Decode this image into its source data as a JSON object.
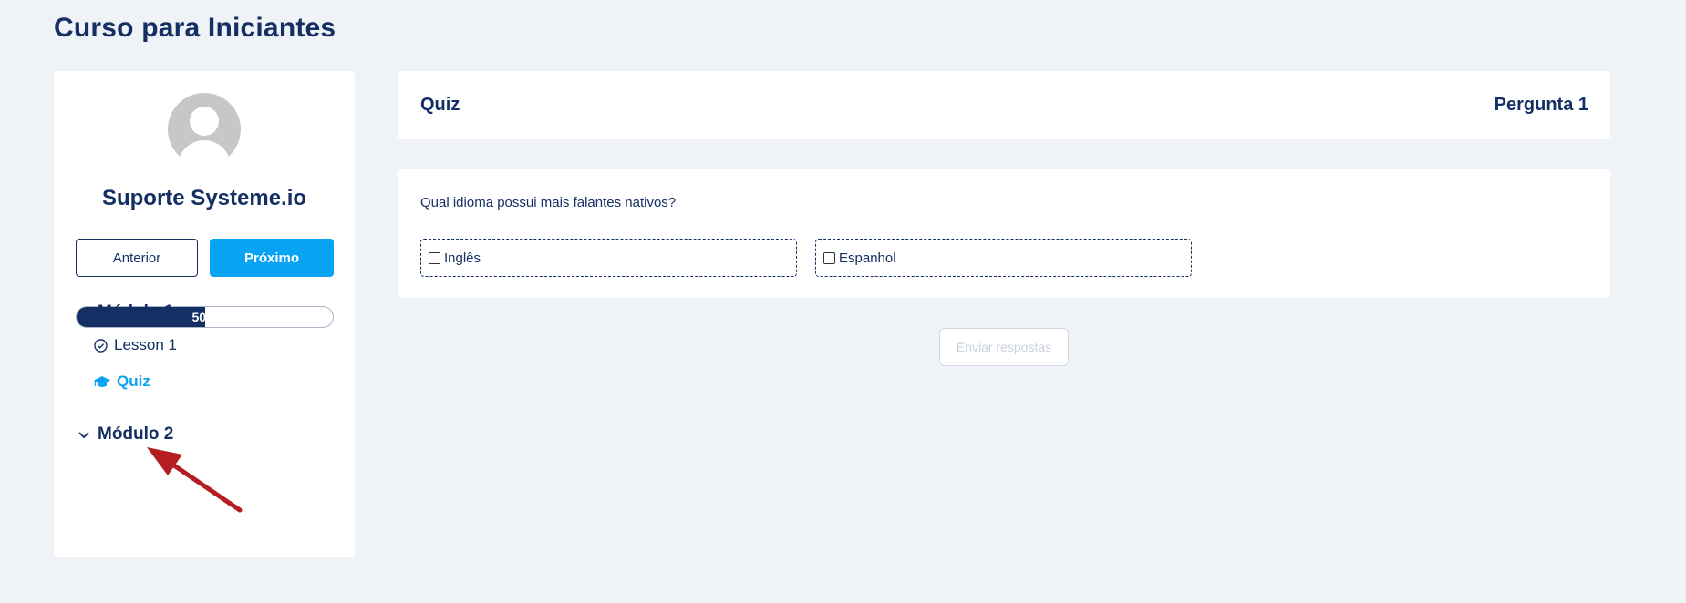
{
  "page": {
    "title": "Curso para Iniciantes"
  },
  "sidebar": {
    "user_name": "Suporte Systeme.io",
    "prev_label": "Anterior",
    "next_label": "Próximo",
    "progress_label": "50%",
    "progress_value": 0.5,
    "modules": [
      {
        "label": "Módulo 1",
        "expanded": true,
        "lessons": [
          {
            "label": "Lesson 1",
            "icon": "check-circle-icon",
            "completed": true
          },
          {
            "label": "Quiz",
            "icon": "graduation-cap-icon",
            "active": true
          }
        ]
      },
      {
        "label": "Módulo 2",
        "expanded": false
      }
    ]
  },
  "quiz": {
    "title": "Quiz",
    "counter": "Pergunta 1",
    "question": "Qual idioma possui mais falantes nativos?",
    "options": [
      {
        "label": "Inglês",
        "checked": false
      },
      {
        "label": "Espanhol",
        "checked": false
      }
    ],
    "submit_label": "Enviar respostas"
  },
  "colors": {
    "primary": "#142f63",
    "accent": "#0aa3f4",
    "background": "#eff3f8",
    "annotation_arrow": "#b41e22"
  }
}
